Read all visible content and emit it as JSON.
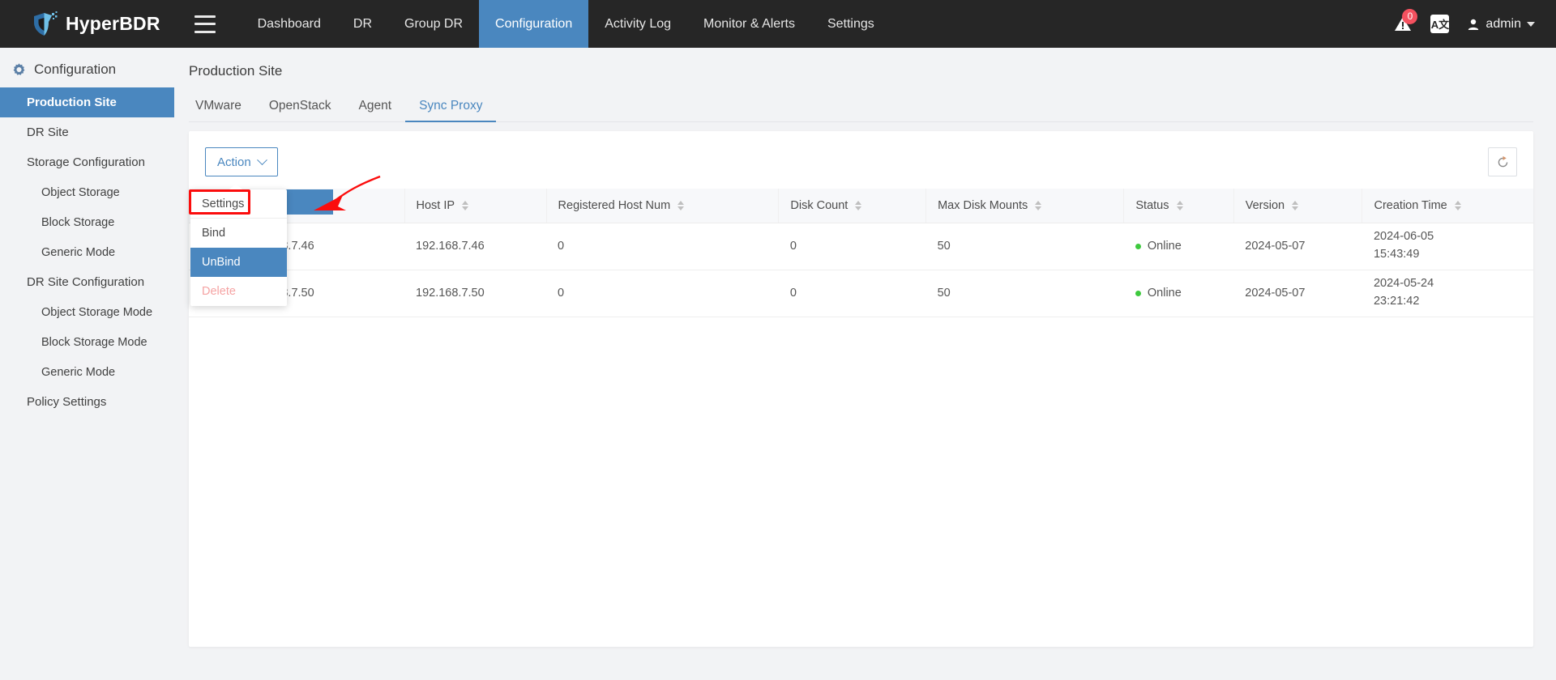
{
  "header": {
    "brand": "HyperBDR",
    "menu_icon": "hamburger-menu-icon",
    "nav": [
      {
        "label": "Dashboard",
        "active": false
      },
      {
        "label": "DR",
        "active": false
      },
      {
        "label": "Group DR",
        "active": false
      },
      {
        "label": "Configuration",
        "active": true
      },
      {
        "label": "Activity Log",
        "active": false
      },
      {
        "label": "Monitor & Alerts",
        "active": false
      },
      {
        "label": "Settings",
        "active": false
      }
    ],
    "alert_badge": "0",
    "alert_icon": "warning-alert-icon",
    "language_icon_label": "A文",
    "user_icon": "user-avatar-icon",
    "user_name": "admin",
    "accent": "#4a87bf",
    "nav_bg": "#262626"
  },
  "sidebar": {
    "title": "Configuration",
    "title_icon": "gear-config-icon",
    "items": [
      {
        "label": "Production Site",
        "level": 1,
        "active": true
      },
      {
        "label": "DR Site",
        "level": 1,
        "active": false
      },
      {
        "label": "Storage Configuration",
        "level": 1,
        "active": false
      },
      {
        "label": "Object Storage",
        "level": 2,
        "active": false
      },
      {
        "label": "Block Storage",
        "level": 2,
        "active": false
      },
      {
        "label": "Generic Mode",
        "level": 2,
        "active": false
      },
      {
        "label": "DR Site Configuration",
        "level": 1,
        "active": false
      },
      {
        "label": "Object Storage Mode",
        "level": 2,
        "active": false
      },
      {
        "label": "Block Storage Mode",
        "level": 2,
        "active": false
      },
      {
        "label": "Generic Mode",
        "level": 2,
        "active": false
      },
      {
        "label": "Policy Settings",
        "level": 1,
        "active": false
      }
    ]
  },
  "main": {
    "page_title": "Production Site",
    "tabs": [
      {
        "label": "VMware",
        "active": false
      },
      {
        "label": "OpenStack",
        "active": false
      },
      {
        "label": "Agent",
        "active": false
      },
      {
        "label": "Sync Proxy",
        "active": true
      }
    ],
    "toolbar": {
      "action_label": "Action",
      "action_chevron": "chevron-down-icon",
      "refresh_icon": "refresh-icon"
    },
    "dropdown": {
      "open": true,
      "items": [
        {
          "label": "Settings",
          "state": "normal"
        },
        {
          "label": "Bind",
          "state": "normal"
        },
        {
          "label": "UnBind",
          "state": "highlighted"
        },
        {
          "label": "Delete",
          "state": "disabled"
        }
      ],
      "annotation": {
        "target": "UnBind",
        "box_color": "#fb0d0d",
        "arrow_color": "#fb0d0d"
      }
    },
    "table": {
      "columns": [
        {
          "label": "",
          "sortable": false,
          "key": "checkbox"
        },
        {
          "label": "",
          "sortable": false,
          "key": "name"
        },
        {
          "label": "Host IP",
          "sortable": true,
          "key": "host_ip"
        },
        {
          "label": "Registered Host Num",
          "sortable": true,
          "key": "registered_host_num"
        },
        {
          "label": "Disk Count",
          "sortable": true,
          "key": "disk_count"
        },
        {
          "label": "Max Disk Mounts",
          "sortable": true,
          "key": "max_disk_mounts"
        },
        {
          "label": "Status",
          "sortable": true,
          "key": "status"
        },
        {
          "label": "Version",
          "sortable": true,
          "key": "version"
        },
        {
          "label": "Creation Time",
          "sortable": true,
          "key": "creation_time"
        }
      ],
      "rows": [
        {
          "name": "192.168.7.46",
          "host_ip": "192.168.7.46",
          "registered_host_num": "0",
          "disk_count": "0",
          "max_disk_mounts": "50",
          "status": "Online",
          "status_color": "#3ec93e",
          "version": "2024-05-07",
          "creation_date": "2024-06-05",
          "creation_time": "15:43:49",
          "selected": false
        },
        {
          "name": "192.168.7.50",
          "host_ip": "192.168.7.50",
          "registered_host_num": "0",
          "disk_count": "0",
          "max_disk_mounts": "50",
          "status": "Online",
          "status_color": "#3ec93e",
          "version": "2024-05-07",
          "creation_date": "2024-05-24",
          "creation_time": "23:21:42",
          "selected": false
        }
      ]
    }
  }
}
